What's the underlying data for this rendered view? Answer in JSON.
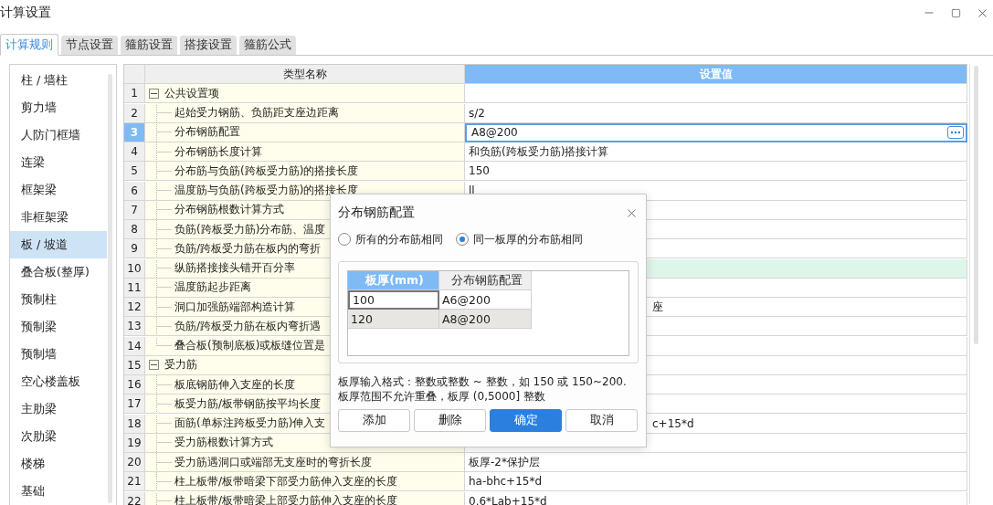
{
  "window": {
    "title": "计算设置"
  },
  "tabs": [
    {
      "label": "计算规则",
      "selected": true
    },
    {
      "label": "节点设置",
      "selected": false
    },
    {
      "label": "箍筋设置",
      "selected": false
    },
    {
      "label": "搭接设置",
      "selected": false
    },
    {
      "label": "箍筋公式",
      "selected": false
    }
  ],
  "sidebar": {
    "items": [
      {
        "label": "柱 / 墙柱",
        "selected": false
      },
      {
        "label": "剪力墙",
        "selected": false
      },
      {
        "label": "人防门框墙",
        "selected": false
      },
      {
        "label": "连梁",
        "selected": false
      },
      {
        "label": "框架梁",
        "selected": false
      },
      {
        "label": "非框架梁",
        "selected": false
      },
      {
        "label": "板 / 坡道",
        "selected": true
      },
      {
        "label": "叠合板(整厚)",
        "selected": false
      },
      {
        "label": "预制柱",
        "selected": false
      },
      {
        "label": "预制梁",
        "selected": false
      },
      {
        "label": "预制墙",
        "selected": false
      },
      {
        "label": "空心楼盖板",
        "selected": false
      },
      {
        "label": "主肋梁",
        "selected": false
      },
      {
        "label": "次肋梁",
        "selected": false
      },
      {
        "label": "楼梯",
        "selected": false
      },
      {
        "label": "基础",
        "selected": false
      }
    ]
  },
  "table": {
    "columns": [
      "类型名称",
      "设置值"
    ],
    "rows": [
      {
        "number": "1",
        "kind": "group",
        "expanded": true,
        "name": "公共设置项",
        "selected": false
      },
      {
        "number": "2",
        "kind": "item",
        "name": "起始受力钢筋、负筋距支座边距离",
        "value": "s/2",
        "selected": false
      },
      {
        "number": "3",
        "kind": "item",
        "name": "分布钢筋配置",
        "value": "A8@200",
        "selected": true
      },
      {
        "number": "4",
        "kind": "item",
        "name": "分布钢筋长度计算",
        "value": "和负筋(跨板受力筋)搭接计算",
        "selected": false
      },
      {
        "number": "5",
        "kind": "item",
        "name": "分布筋与负筋(跨板受力筋)的搭接长度",
        "value": "150",
        "selected": false
      },
      {
        "number": "6",
        "kind": "item",
        "name": "温度筋与负筋(跨板受力筋)的搭接长度",
        "value": "ll",
        "selected": false
      },
      {
        "number": "7",
        "kind": "item",
        "name": "分布钢筋根数计算方式",
        "selected": false
      },
      {
        "number": "8",
        "kind": "item",
        "name": "负筋(跨板受力筋)分布筋、温度",
        "selected": false
      },
      {
        "number": "9",
        "kind": "item",
        "name": "负筋/跨板受力筋在板内的弯折",
        "selected": false
      },
      {
        "number": "10",
        "kind": "item",
        "name": "纵筋搭接接头错开百分率",
        "selected": false,
        "highlighted": true
      },
      {
        "number": "11",
        "kind": "item",
        "name": "温度筋起步距离",
        "selected": false
      },
      {
        "number": "12",
        "kind": "item",
        "name": "洞口加强筋端部构造计算",
        "value": "座",
        "covered": true,
        "selected": false
      },
      {
        "number": "13",
        "kind": "item",
        "name": "负筋/跨板受力筋在板内弯折遇",
        "selected": false
      },
      {
        "number": "14",
        "kind": "last",
        "name": "叠合板(预制底板)或板缝位置是",
        "selected": false
      },
      {
        "number": "15",
        "kind": "group",
        "expanded": true,
        "name": "受力筋",
        "selected": false
      },
      {
        "number": "16",
        "kind": "item",
        "name": "板底钢筋伸入支座的长度",
        "selected": false
      },
      {
        "number": "17",
        "kind": "item",
        "name": "板受力筋/板带钢筋按平均长度",
        "selected": false
      },
      {
        "number": "18",
        "kind": "item",
        "name": "面筋(单标注跨板受力筋)伸入支",
        "value": "c+15*d",
        "covered": true,
        "selected": false
      },
      {
        "number": "19",
        "kind": "item",
        "name": "受力筋根数计算方式",
        "selected": false
      },
      {
        "number": "20",
        "kind": "item",
        "name": "受力筋遇洞口或端部无支座时的弯折长度",
        "value": "板厚-2*保护层",
        "selected": false
      },
      {
        "number": "21",
        "kind": "item",
        "name": "柱上板带/板带暗梁下部受力筋伸入支座的长度",
        "value": "ha-bhc+15*d",
        "selected": false
      },
      {
        "number": "22",
        "kind": "item",
        "name": "柱上板带/板带暗梁上部受力筋伸入支座的长度",
        "value": "0.6*Lab+15*d",
        "selected": false
      }
    ]
  },
  "dialog": {
    "title": "分布钢筋配置",
    "radios": [
      {
        "label": "所有的分布筋相同",
        "selected": false
      },
      {
        "label": "同一板厚的分布筋相同",
        "selected": true
      }
    ],
    "grid": {
      "columns": [
        {
          "label": "板厚(mm)",
          "selected": true
        },
        {
          "label": "分布钢筋配置",
          "selected": false
        }
      ],
      "rows": [
        {
          "selected": false,
          "cells": [
            {
              "text": "100",
              "focused": true
            },
            {
              "text": "A6@200",
              "focused": false
            }
          ]
        },
        {
          "selected": true,
          "cells": [
            {
              "text": "120",
              "focused": false
            },
            {
              "text": "A8@200",
              "focused": false
            }
          ]
        }
      ]
    },
    "help": [
      "板厚输入格式：整数或整数 ~ 整数，如 150 或 150~200.",
      "板厚范围不允许重叠，板厚 (0,5000] 整数"
    ],
    "buttons": [
      {
        "label": "添加",
        "primary": false
      },
      {
        "label": "删除",
        "primary": false
      },
      {
        "label": "确定",
        "primary": true
      },
      {
        "label": "取消",
        "primary": false
      }
    ]
  }
}
